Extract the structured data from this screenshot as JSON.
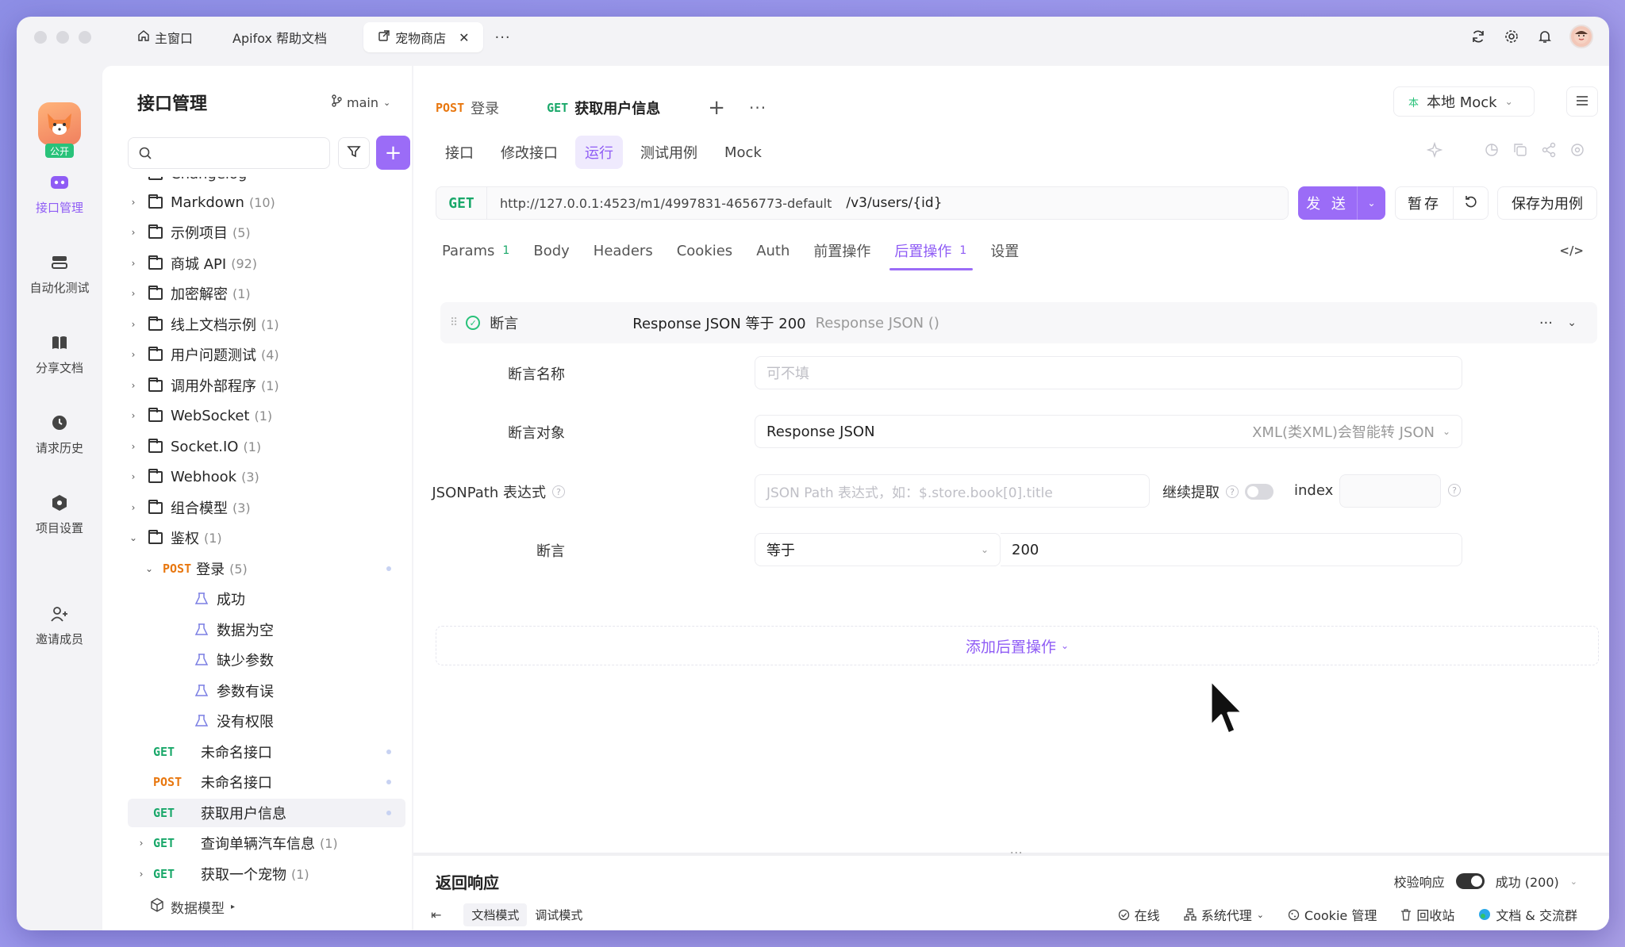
{
  "window_tabs": [
    {
      "label": "主窗口",
      "icon": "home-icon"
    },
    {
      "label": "Apifox 帮助文档"
    },
    {
      "label": "宠物商店",
      "icon": "external-link-icon",
      "active": true
    }
  ],
  "rail": {
    "logo_badge": "公开",
    "items": [
      {
        "label": "接口管理",
        "icon": "api-icon",
        "active": true
      },
      {
        "label": "自动化测试",
        "icon": "stack-icon"
      },
      {
        "label": "分享文档",
        "icon": "book-icon"
      },
      {
        "label": "请求历史",
        "icon": "clock-icon"
      },
      {
        "label": "项目设置",
        "icon": "settings-hex-icon"
      },
      {
        "label": "邀请成员",
        "icon": "user-plus-icon"
      }
    ]
  },
  "sidebar": {
    "title": "接口管理",
    "branch": "main",
    "footer": "数据模型",
    "tree": [
      {
        "type": "folder",
        "name": "Markdown",
        "count": "(10)"
      },
      {
        "type": "folder",
        "name": "示例项目",
        "count": "(5)"
      },
      {
        "type": "folder",
        "name": "商城 API",
        "count": "(92)"
      },
      {
        "type": "folder",
        "name": "加密解密",
        "count": "(1)"
      },
      {
        "type": "folder",
        "name": "线上文档示例",
        "count": "(1)"
      },
      {
        "type": "folder",
        "name": "用户问题测试",
        "count": "(4)"
      },
      {
        "type": "folder",
        "name": "调用外部程序",
        "count": "(1)"
      },
      {
        "type": "folder",
        "name": "WebSocket",
        "count": "(1)"
      },
      {
        "type": "folder",
        "name": "Socket.IO",
        "count": "(1)"
      },
      {
        "type": "folder",
        "name": "Webhook",
        "count": "(3)"
      },
      {
        "type": "folder",
        "name": "组合模型",
        "count": "(3)"
      },
      {
        "type": "folder",
        "name": "鉴权",
        "count": "(1)",
        "expanded": true
      }
    ],
    "auth_children": {
      "endpoint": {
        "method": "POST",
        "name": "登录",
        "count": "(5)"
      },
      "cases": [
        "成功",
        "数据为空",
        "缺少参数",
        "参数有误",
        "没有权限"
      ],
      "apis": [
        {
          "method": "GET",
          "name": "未命名接口"
        },
        {
          "method": "POST",
          "name": "未命名接口"
        },
        {
          "method": "GET",
          "name": "获取用户信息",
          "selected": true
        },
        {
          "method": "GET",
          "name": "查询单辆汽车信息",
          "count": "(1)"
        },
        {
          "method": "GET",
          "name": "获取一个宠物",
          "count": "(1)"
        }
      ]
    }
  },
  "request_tabs": [
    {
      "method": "POST",
      "name": "登录"
    },
    {
      "method": "GET",
      "name": "获取用户信息",
      "active": true
    }
  ],
  "environment": "本地 Mock",
  "sub_tabs": [
    "接口",
    "修改接口",
    "运行",
    "测试用例",
    "Mock"
  ],
  "url": {
    "method": "GET",
    "base": "http://127.0.0.1:4523/m1/4997831-4656773-default",
    "path": "/v3/users/{id}"
  },
  "buttons": {
    "send": "发 送",
    "save": "暂存",
    "save_case": "保存为用例"
  },
  "param_tabs": [
    {
      "label": "Params",
      "count": "1"
    },
    {
      "label": "Body"
    },
    {
      "label": "Headers"
    },
    {
      "label": "Cookies"
    },
    {
      "label": "Auth"
    },
    {
      "label": "前置操作"
    },
    {
      "label": "后置操作",
      "count": "1",
      "active": true
    },
    {
      "label": "设置"
    }
  ],
  "assertion": {
    "type": "断言",
    "summary": "Response JSON 等于 200",
    "summary_sub": "Response JSON ()",
    "name_label": "断言名称",
    "name_placeholder": "可不填",
    "target_label": "断言对象",
    "target_value": "Response JSON",
    "target_option": "XML(类XML)会智能转 JSON",
    "jsonpath_label": "JSONPath 表达式",
    "jsonpath_placeholder": "JSON Path 表达式，如：$.store.book[0].title",
    "continue_label": "继续提取",
    "index_label": "index",
    "assert_label": "断言",
    "operator": "等于",
    "value": "200"
  },
  "add_post_action": "添加后置操作",
  "response": {
    "title": "返回响应",
    "validate_label": "校验响应",
    "status": "成功 (200)"
  },
  "statusbar": {
    "modes": [
      "文档模式",
      "调试模式"
    ],
    "online": "在线",
    "proxy": "系统代理",
    "cookie": "Cookie 管理",
    "trash": "回收站",
    "docs": "文档 & 交流群"
  },
  "colors": {
    "accent": "#9b6cf7",
    "get": "#1aa86a",
    "post": "#e8770f"
  }
}
